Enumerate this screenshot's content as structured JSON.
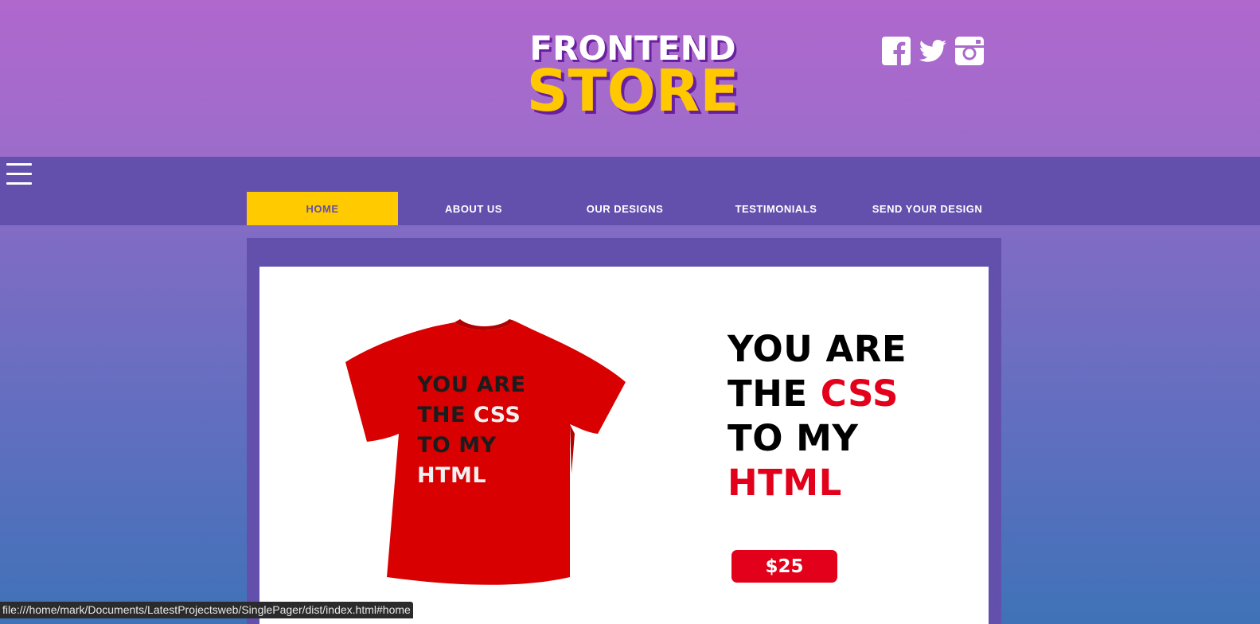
{
  "brand": {
    "line1": "FRONTEND",
    "line2": "STORE"
  },
  "social": [
    "facebook-icon",
    "twitter-icon",
    "instagram-icon"
  ],
  "nav": {
    "items": [
      {
        "label": "HOME",
        "active": true
      },
      {
        "label": "ABOUT US",
        "active": false
      },
      {
        "label": "OUR DESIGNS",
        "active": false
      },
      {
        "label": "TESTIMONIALS",
        "active": false
      },
      {
        "label": "SEND YOUR DESIGN",
        "active": false
      }
    ]
  },
  "product": {
    "shirt_print": {
      "line1": "YOU ARE",
      "line2_a": "THE",
      "line2_b": "CSS",
      "line3": "TO MY",
      "line4": "HTML"
    },
    "slogan": {
      "line1": "YOU ARE",
      "line2_a": "THE",
      "line2_b": "CSS",
      "line3": "TO MY",
      "line4": "HTML"
    },
    "price": "$25"
  },
  "status_bar": {
    "url": "file:///home/mark/Documents/LatestProjectsweb/SinglePager/dist/index.html#home"
  },
  "colors": {
    "purple_header": "#b068cd",
    "nav_bg": "#6350ad",
    "accent_yellow": "#ffcb00",
    "red": "#e3001b"
  }
}
